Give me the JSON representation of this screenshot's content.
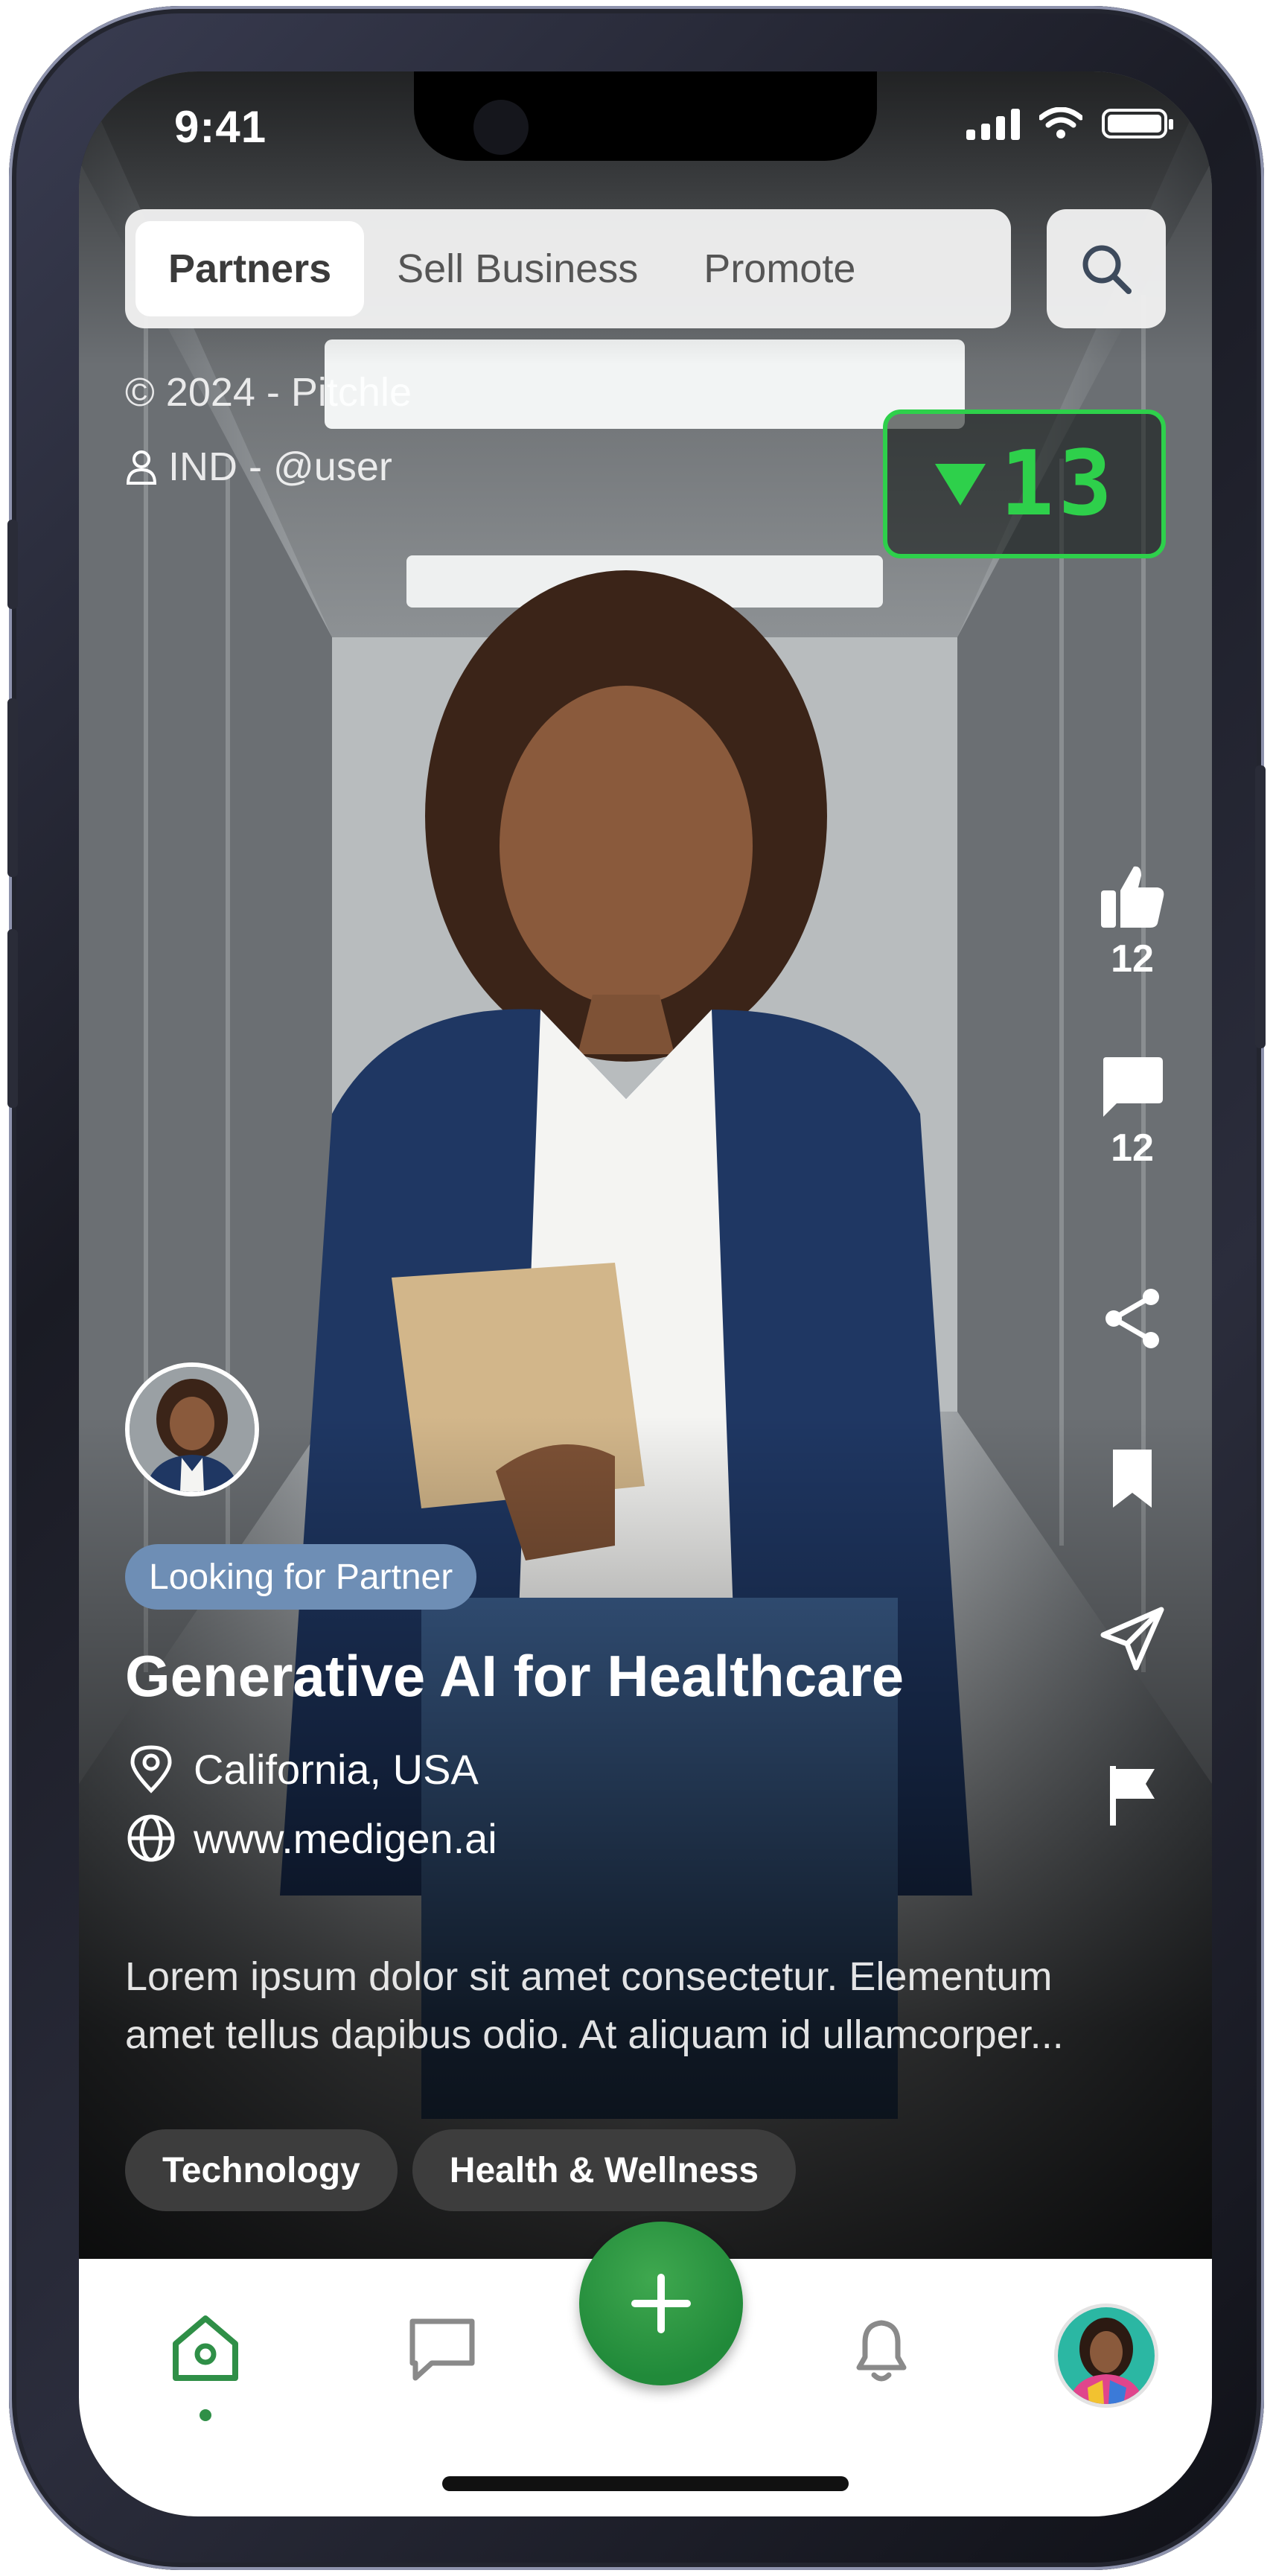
{
  "status_bar": {
    "time": "9:41"
  },
  "tabs": {
    "items": [
      {
        "label": "Partners",
        "active": true
      },
      {
        "label": "Sell Business",
        "active": false
      },
      {
        "label": "Promote",
        "active": false
      }
    ],
    "search_icon": "search-icon"
  },
  "meta": {
    "copyright": "© 2024 - Pitchle",
    "user": "IND - @user"
  },
  "counter": {
    "direction": "down",
    "value": "13",
    "color": "#2ed04b"
  },
  "actions": {
    "like": {
      "icon": "thumbs-up-icon",
      "count": "12"
    },
    "comment": {
      "icon": "comment-icon",
      "count": "12"
    },
    "share_icon": "share-icon",
    "bookmark_icon": "bookmark-icon",
    "send_icon": "send-icon",
    "report_icon": "flag-icon"
  },
  "post": {
    "badge": "Looking for Partner",
    "title": "Generative AI for Healthcare",
    "location": "California, USA",
    "website": "www.medigen.ai",
    "description_lines": [
      "Lorem ipsum dolor sit amet consectetur. Elementum",
      "amet tellus dapibus odio. At aliquam id ullamcorper..."
    ],
    "tags": [
      "Technology",
      "Health & Wellness"
    ]
  },
  "nav": {
    "items": [
      "home-icon",
      "chat-icon",
      "add-icon",
      "bell-icon",
      "profile-avatar"
    ],
    "active": "home-icon",
    "accent": "#2f8f47"
  }
}
